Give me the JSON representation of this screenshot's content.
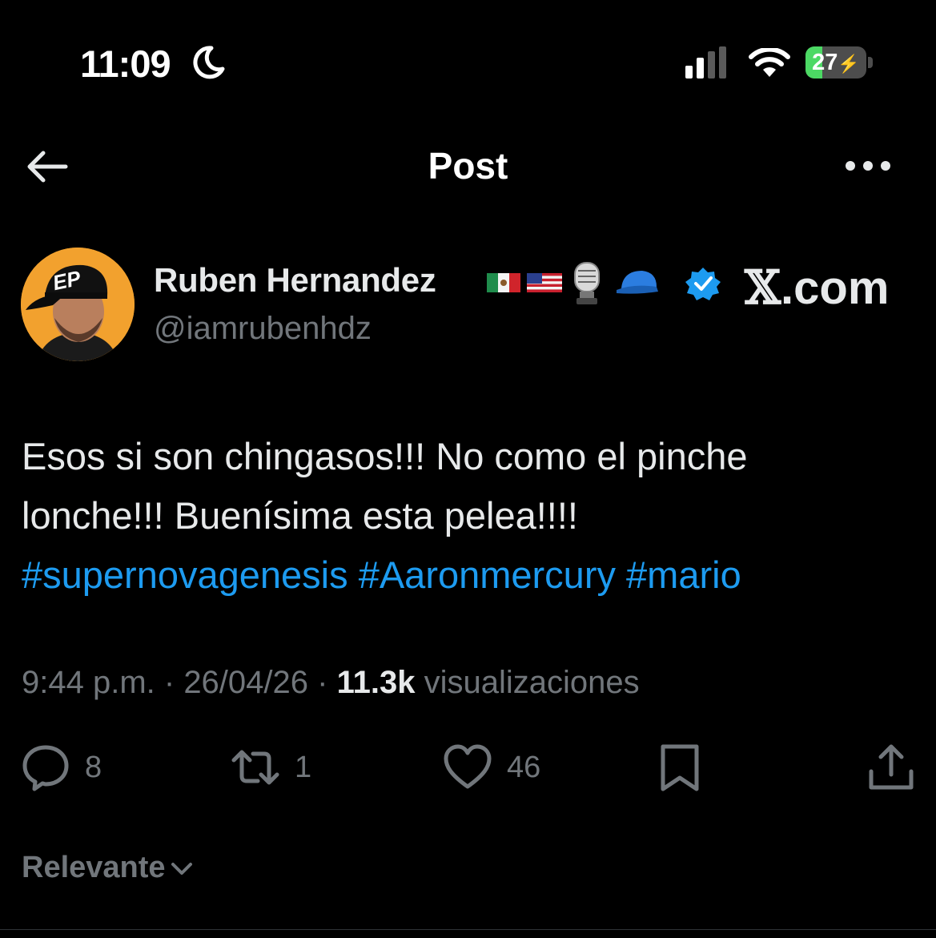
{
  "status_bar": {
    "time": "11:09",
    "battery_percent": "27",
    "battery_level": 0.27,
    "icons": [
      "moon-icon",
      "cellular-signal-icon",
      "wifi-icon",
      "battery-icon",
      "charging-bolt-icon"
    ]
  },
  "header": {
    "title": "Post",
    "icons": [
      "back-arrow-icon",
      "more-options-icon"
    ]
  },
  "author": {
    "name": "Ruben Hernandez",
    "handle": "@iamrubenhdz",
    "badges": [
      "mexico-flag-icon",
      "usa-flag-icon",
      "microphone-icon",
      "blue-cap-icon",
      "verified-badge-icon"
    ],
    "avatar_cap_text": "EP"
  },
  "watermark": {
    "x_letter": "𝕏",
    "domain": ".com"
  },
  "tweet": {
    "line1": "Esos si son chingasos!!! No como el pinche",
    "line2": "lonche!!! Buenísima esta pelea!!!!",
    "hashtags": [
      "#supernovagenesis",
      "#Aaronmercury",
      "#mario"
    ]
  },
  "meta": {
    "time": "9:44 p.m.",
    "sep1": " · ",
    "date": "26/04/26",
    "sep2": " · ",
    "views": "11.3k",
    "views_label": " visualizaciones"
  },
  "actions": {
    "replies": "8",
    "reposts": "1",
    "likes": "46"
  },
  "sort": {
    "label": "Relevante"
  },
  "colors": {
    "background": "#000000",
    "accent": "#1d9bf0",
    "muted": "#71767b",
    "text": "#e7e9ea",
    "battery_fill": "#4cd964",
    "avatar_bg": "#f2a12e"
  }
}
